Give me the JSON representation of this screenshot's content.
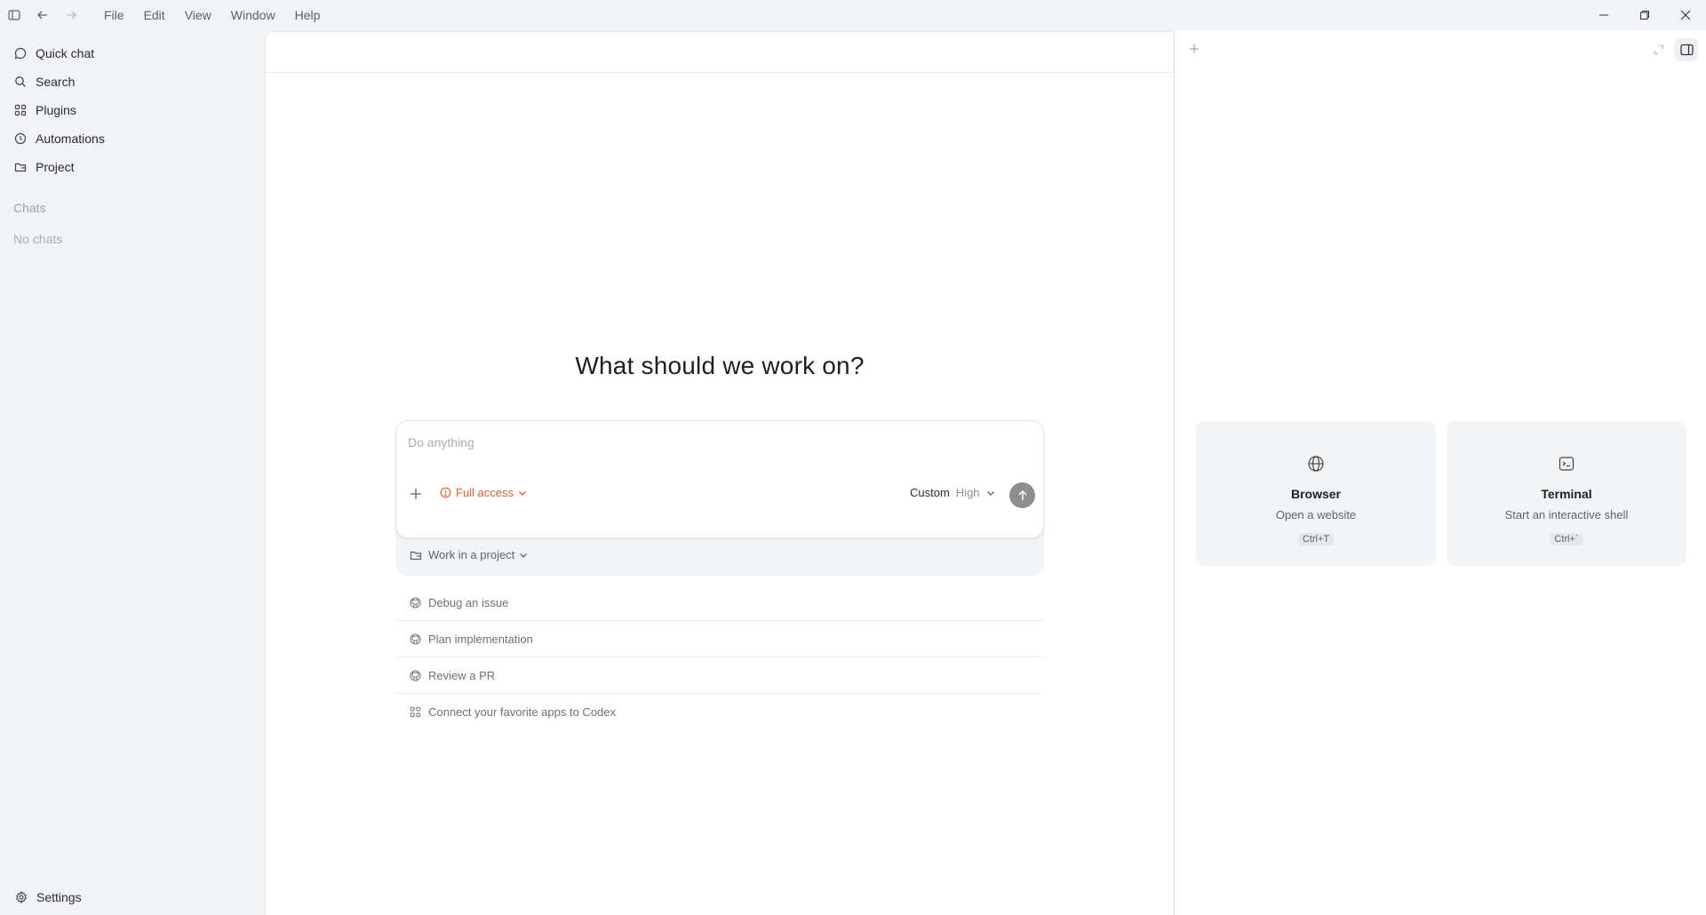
{
  "menu": [
    "File",
    "Edit",
    "View",
    "Window",
    "Help"
  ],
  "sidebar": {
    "items": [
      {
        "label": "Quick chat",
        "icon": "chat-bubble-icon"
      },
      {
        "label": "Search",
        "icon": "search-icon"
      },
      {
        "label": "Plugins",
        "icon": "grid-icon"
      },
      {
        "label": "Automations",
        "icon": "clock-icon"
      },
      {
        "label": "Project",
        "icon": "folder-icon"
      }
    ],
    "chats_title": "Chats",
    "no_chats": "No chats",
    "settings": "Settings"
  },
  "main": {
    "heading": "What should we work on?",
    "composer": {
      "placeholder": "Do anything",
      "access_label": "Full access",
      "model_name": "Custom",
      "model_level": "High",
      "project_label": "Work in a project"
    },
    "suggestions": [
      {
        "label": "Debug an issue",
        "icon": "github-icon"
      },
      {
        "label": "Plan implementation",
        "icon": "github-icon"
      },
      {
        "label": "Review a PR",
        "icon": "github-icon"
      },
      {
        "label": "Connect your favorite apps to Codex",
        "icon": "grid-icon"
      }
    ]
  },
  "right_panel": {
    "cards": [
      {
        "title": "Browser",
        "subtitle": "Open a website",
        "shortcut": "Ctrl+T",
        "icon": "globe-icon"
      },
      {
        "title": "Terminal",
        "subtitle": "Start an interactive shell",
        "shortcut": "Ctrl+`",
        "icon": "terminal-icon"
      }
    ]
  },
  "colors": {
    "accent_orange": "#e0602b",
    "sidebar_bg": "#f1f3f7",
    "send_button": "#8e8e8e"
  }
}
